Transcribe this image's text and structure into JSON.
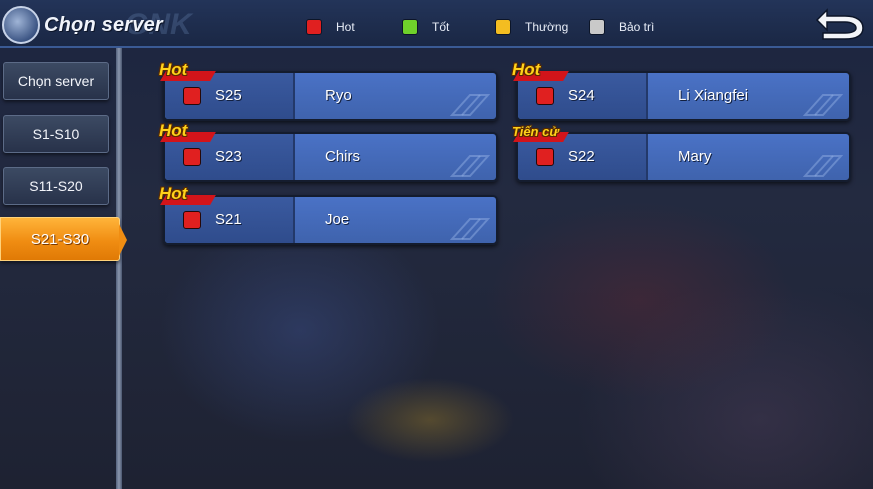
{
  "header": {
    "title": "Chọn server",
    "watermark": "GNK",
    "legend": [
      {
        "label": "Hot",
        "color": "#e02020"
      },
      {
        "label": "Tốt",
        "color": "#6fd12b"
      },
      {
        "label": "Thường",
        "color": "#f3bd21"
      },
      {
        "label": "Bảo trì",
        "color": "#c9c9c9"
      }
    ]
  },
  "sidebar": {
    "items": [
      {
        "label": "Chọn server"
      },
      {
        "label": "S1-S10"
      },
      {
        "label": "S11-S20"
      },
      {
        "label": "S21-S30",
        "active": true
      }
    ]
  },
  "servers": [
    {
      "tag": "Hot",
      "id": "S25",
      "name": "Ryo",
      "status_color": "#e02020"
    },
    {
      "tag": "Hot",
      "id": "S24",
      "name": "Li Xiangfei",
      "status_color": "#e02020"
    },
    {
      "tag": "Hot",
      "id": "S23",
      "name": "Chirs",
      "status_color": "#e02020"
    },
    {
      "tag": "Tiến cử",
      "id": "S22",
      "name": "Mary",
      "status_color": "#e02020"
    },
    {
      "tag": "Hot",
      "id": "S21",
      "name": "Joe",
      "status_color": "#e02020"
    }
  ],
  "icons": {
    "back": "back-arrow-icon",
    "globe": "globe-logo-icon"
  }
}
